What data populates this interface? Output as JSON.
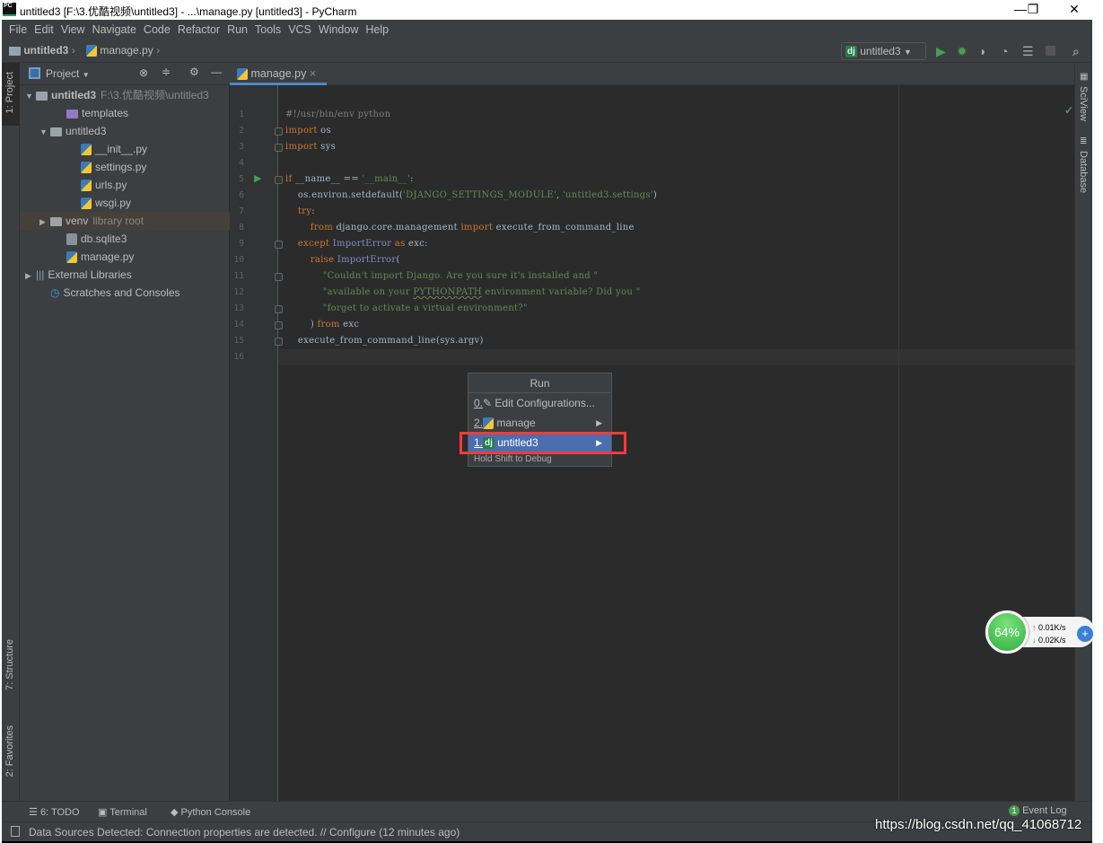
{
  "window": {
    "title": "untitled3 [F:\\3.优酷视频\\untitled3] - ...\\manage.py [untitled3] - PyCharm",
    "app_icon": "PC",
    "minimize": "—",
    "maximize": "❐",
    "close": "✕"
  },
  "menu": [
    "File",
    "Edit",
    "View",
    "Navigate",
    "Code",
    "Refactor",
    "Run",
    "Tools",
    "VCS",
    "Window",
    "Help"
  ],
  "nav": {
    "project": "untitled3",
    "file": "manage.py"
  },
  "toolbar": {
    "run_config_badge": "dj",
    "run_config": "untitled3",
    "icons": [
      "run-icon",
      "debug-icon",
      "coverage-icon",
      "profile-icon",
      "concurrency-icon",
      "stop-icon",
      "search-icon"
    ]
  },
  "left_stripe": {
    "project": "1: Project",
    "structure": "7: Structure",
    "favorites": "2: Favorites"
  },
  "project_panel": {
    "title": "Project",
    "tree": [
      {
        "label": "untitled3",
        "hint": "F:\\3.优酷视频\\untitled3",
        "icon": "folder",
        "arrow": "▼",
        "bold": true
      },
      {
        "label": "templates",
        "icon": "folder-purple",
        "arrow": ""
      },
      {
        "label": "untitled3",
        "icon": "package",
        "arrow": "▼"
      },
      {
        "label": "__init__.py",
        "icon": "python-file",
        "arrow": ""
      },
      {
        "label": "settings.py",
        "icon": "python-file",
        "arrow": ""
      },
      {
        "label": "urls.py",
        "icon": "python-file",
        "arrow": ""
      },
      {
        "label": "wsgi.py",
        "icon": "python-file",
        "arrow": ""
      },
      {
        "label": "venv",
        "hint": "library root",
        "icon": "package",
        "arrow": "▶",
        "selected": true
      },
      {
        "label": "db.sqlite3",
        "icon": "unknown-file",
        "arrow": ""
      },
      {
        "label": "manage.py",
        "icon": "python-file",
        "arrow": ""
      },
      {
        "label": "External Libraries",
        "icon": "libraries",
        "arrow": "▶"
      },
      {
        "label": "Scratches and Consoles",
        "icon": "scratches",
        "arrow": ""
      }
    ]
  },
  "editor": {
    "tab": "manage.py",
    "lines": [
      [
        [
          "#!/usr/bin/env python",
          "cm"
        ]
      ],
      [
        [
          "import",
          "kw"
        ],
        [
          " os",
          ""
        ]
      ],
      [
        [
          "import",
          "kw"
        ],
        [
          " sys",
          ""
        ]
      ],
      [],
      [
        [
          "if",
          "kw"
        ],
        [
          " __name__ == ",
          ""
        ],
        [
          "'__main__'",
          "str"
        ],
        [
          ":",
          ""
        ]
      ],
      [
        [
          "    os.environ.setdefault(",
          ""
        ],
        [
          "'DJANGO_SETTINGS_MODULE'",
          "str"
        ],
        [
          ", ",
          ""
        ],
        [
          "'untitled3.settings'",
          "str"
        ],
        [
          ")",
          ""
        ]
      ],
      [
        [
          "    try",
          "kw"
        ],
        [
          ":",
          ""
        ]
      ],
      [
        [
          "        from",
          "kw"
        ],
        [
          " django.core.management ",
          ""
        ],
        [
          "import",
          "kw"
        ],
        [
          " execute_from_command_line",
          ""
        ]
      ],
      [
        [
          "    except",
          "kw"
        ],
        [
          " ",
          ""
        ],
        [
          "ImportError",
          "cls"
        ],
        [
          " as",
          "kw"
        ],
        [
          " exc:",
          ""
        ]
      ],
      [
        [
          "        raise",
          "kw"
        ],
        [
          " ",
          ""
        ],
        [
          "ImportError",
          "cls"
        ],
        [
          "(",
          ""
        ]
      ],
      [
        [
          "            \"Couldn't import Django. Are you sure it's installed and \"",
          "str"
        ]
      ],
      [
        [
          "            \"available on your ",
          "str"
        ],
        [
          "PYTHONPATH",
          "str und"
        ],
        [
          " environment variable? Did you \"",
          "str"
        ]
      ],
      [
        [
          "            \"forget to activate a virtual environment?\"",
          "str"
        ]
      ],
      [
        [
          "        ) ",
          ""
        ],
        [
          "from",
          "kw"
        ],
        [
          " exc",
          ""
        ]
      ],
      [
        [
          "    execute_from_command_line(sys.argv)",
          ""
        ]
      ],
      []
    ]
  },
  "run_popup": {
    "title": "Run",
    "items": [
      {
        "mnemonic": "0.",
        "label": "Edit Configurations...",
        "icon": "edit-icon"
      },
      {
        "mnemonic": "2.",
        "label": "manage",
        "icon": "python-icon",
        "submenu": "▶"
      },
      {
        "mnemonic": "1.",
        "label": "untitled3",
        "icon": "django-icon",
        "badge": "dj",
        "submenu": "▶",
        "selected": true
      }
    ],
    "footer": "Hold Shift to Debug",
    "highlight_color": "#f23b3b"
  },
  "right_stripe": {
    "sciview": "SciView",
    "database": "Database"
  },
  "bottom_tools": [
    {
      "label": "6: TODO",
      "icon": "todo-icon"
    },
    {
      "label": "Terminal",
      "icon": "terminal-icon"
    },
    {
      "label": "Python Console",
      "icon": "python-console-icon"
    }
  ],
  "event_log": {
    "count": "1",
    "label": "Event Log"
  },
  "status": "Data Sources Detected: Connection properties are detected. // Configure (12 minutes ago)",
  "net_monitor": {
    "percent": "64%",
    "up": "0.01K/s",
    "down": "0.02K/s"
  },
  "watermark": "https://blog.csdn.net/qq_41068712"
}
